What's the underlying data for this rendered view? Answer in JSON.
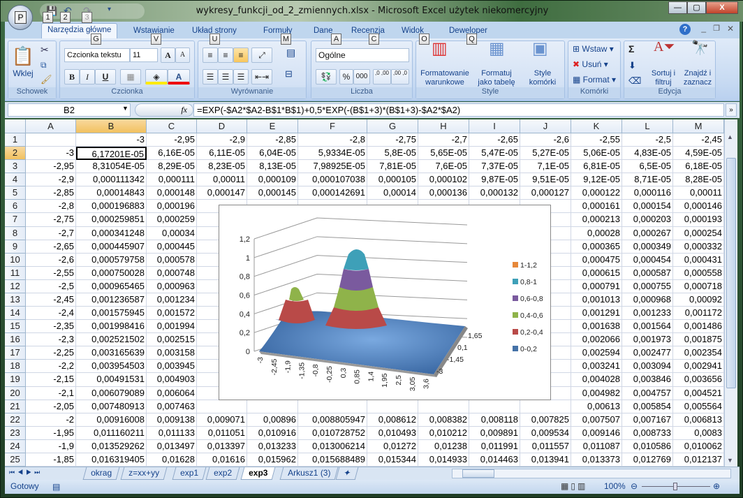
{
  "window": {
    "title": "wykresy_funkcji_od_2_zmiennych.xlsx - Microsoft Excel użytek niekomercyjny",
    "office_button_key": "P",
    "qat_keytips": [
      "1",
      "2",
      "3"
    ],
    "minimize": "—",
    "maximize": "▢",
    "close": "X"
  },
  "ribbon_tabs": [
    {
      "label": "Narzędzia główne",
      "key": "G",
      "active": true
    },
    {
      "label": "Wstawianie",
      "key": "V"
    },
    {
      "label": "Układ strony",
      "key": "U"
    },
    {
      "label": "Formuły",
      "key": "M"
    },
    {
      "label": "Dane",
      "key": "A"
    },
    {
      "label": "Recenzja",
      "key": "C"
    },
    {
      "label": "Widok",
      "key": "O"
    },
    {
      "label": "Deweloper",
      "key": "Q"
    }
  ],
  "ribbon": {
    "clipboard": {
      "label": "Schowek",
      "paste": "Wklej"
    },
    "font": {
      "label": "Czcionka",
      "font_name": "Czcionka tekstu",
      "font_size": "11",
      "bold": "B",
      "italic": "I",
      "underline": "U",
      "grow": "A",
      "shrink": "A",
      "font_color": "A"
    },
    "alignment": {
      "label": "Wyrównanie"
    },
    "number": {
      "label": "Liczba",
      "format": "Ogólne",
      "percent": "%",
      "thousands": "000",
      "inc_dec": ",0 ,00",
      "dec_dec": ",00 ,0"
    },
    "styles": {
      "label": "Style",
      "conditional": "Formatowanie warunkowe",
      "as_table": "Formatuj jako tabelę",
      "cell_styles": "Style komórki"
    },
    "cells": {
      "label": "Komórki",
      "insert": "Wstaw",
      "delete": "Usuń",
      "format": "Format"
    },
    "editing": {
      "label": "Edycja",
      "sum": "Σ",
      "sort": "Sortuj i filtruj",
      "find": "Znajdź i zaznacz"
    }
  },
  "formula_bar": {
    "name_box": "B2",
    "fx": "fx",
    "formula": "=EXP(-$A2*$A2-B$1*B$1)+0,5*EXP(-(B$1+3)*(B$1+3)-$A2*$A2)"
  },
  "grid": {
    "columns": [
      "A",
      "B",
      "C",
      "D",
      "E",
      "F",
      "G",
      "H",
      "I",
      "J",
      "K",
      "L",
      "M"
    ],
    "selected_cell": "B2",
    "rows": [
      {
        "n": "1",
        "cells": [
          "",
          "-3",
          "-2,95",
          "-2,9",
          "-2,85",
          "-2,8",
          "-2,75",
          "-2,7",
          "-2,65",
          "-2,6",
          "-2,55",
          "-2,5",
          "-2,45"
        ]
      },
      {
        "n": "2",
        "cells": [
          "-3",
          "6,17201E-05",
          "6,16E-05",
          "6,11E-05",
          "6,04E-05",
          "5,9334E-05",
          "5,8E-05",
          "5,65E-05",
          "5,47E-05",
          "5,27E-05",
          "5,06E-05",
          "4,83E-05",
          "4,59E-05"
        ]
      },
      {
        "n": "3",
        "cells": [
          "-2,95",
          "8,31054E-05",
          "8,29E-05",
          "8,23E-05",
          "8,13E-05",
          "7,98925E-05",
          "7,81E-05",
          "7,6E-05",
          "7,37E-05",
          "7,1E-05",
          "6,81E-05",
          "6,5E-05",
          "6,18E-05"
        ]
      },
      {
        "n": "4",
        "cells": [
          "-2,9",
          "0,000111342",
          "0,000111",
          "0,00011",
          "0,000109",
          "0,000107038",
          "0,000105",
          "0,000102",
          "9,87E-05",
          "9,51E-05",
          "9,12E-05",
          "8,71E-05",
          "8,28E-05"
        ]
      },
      {
        "n": "5",
        "cells": [
          "-2,85",
          "0,00014843",
          "0,000148",
          "0,000147",
          "0,000145",
          "0,000142691",
          "0,00014",
          "0,000136",
          "0,000132",
          "0,000127",
          "0,000122",
          "0,000116",
          "0,00011"
        ]
      },
      {
        "n": "6",
        "cells": [
          "-2,8",
          "0,000196883",
          "0,000196",
          "",
          "",
          "",
          "",
          "",
          "",
          "",
          "0,000161",
          "0,000154",
          "0,000146"
        ]
      },
      {
        "n": "7",
        "cells": [
          "-2,75",
          "0,000259851",
          "0,000259",
          "",
          "",
          "",
          "",
          "",
          "",
          "",
          "0,000213",
          "0,000203",
          "0,000193"
        ]
      },
      {
        "n": "8",
        "cells": [
          "-2,7",
          "0,000341248",
          "0,00034",
          "",
          "",
          "",
          "",
          "",
          "",
          "",
          "0,00028",
          "0,000267",
          "0,000254"
        ]
      },
      {
        "n": "9",
        "cells": [
          "-2,65",
          "0,000445907",
          "0,000445",
          "",
          "",
          "",
          "",
          "",
          "",
          "",
          "0,000365",
          "0,000349",
          "0,000332"
        ]
      },
      {
        "n": "10",
        "cells": [
          "-2,6",
          "0,000579758",
          "0,000578",
          "",
          "",
          "",
          "",
          "",
          "",
          "",
          "0,000475",
          "0,000454",
          "0,000431"
        ]
      },
      {
        "n": "11",
        "cells": [
          "-2,55",
          "0,000750028",
          "0,000748",
          "",
          "",
          "",
          "",
          "",
          "",
          "",
          "0,000615",
          "0,000587",
          "0,000558"
        ]
      },
      {
        "n": "12",
        "cells": [
          "-2,5",
          "0,000965465",
          "0,000963",
          "",
          "",
          "",
          "",
          "",
          "",
          "",
          "0,000791",
          "0,000755",
          "0,000718"
        ]
      },
      {
        "n": "13",
        "cells": [
          "-2,45",
          "0,001236587",
          "0,001234",
          "",
          "",
          "",
          "",
          "",
          "",
          "",
          "0,001013",
          "0,000968",
          "0,00092"
        ]
      },
      {
        "n": "14",
        "cells": [
          "-2,4",
          "0,001575945",
          "0,001572",
          "",
          "",
          "",
          "",
          "",
          "",
          "",
          "0,001291",
          "0,001233",
          "0,001172"
        ]
      },
      {
        "n": "15",
        "cells": [
          "-2,35",
          "0,001998416",
          "0,001994",
          "",
          "",
          "",
          "",
          "",
          "",
          "",
          "0,001638",
          "0,001564",
          "0,001486"
        ]
      },
      {
        "n": "16",
        "cells": [
          "-2,3",
          "0,002521502",
          "0,002515",
          "",
          "",
          "",
          "",
          "",
          "",
          "",
          "0,002066",
          "0,001973",
          "0,001875"
        ]
      },
      {
        "n": "17",
        "cells": [
          "-2,25",
          "0,003165639",
          "0,003158",
          "",
          "",
          "",
          "",
          "",
          "",
          "",
          "0,002594",
          "0,002477",
          "0,002354"
        ]
      },
      {
        "n": "18",
        "cells": [
          "-2,2",
          "0,003954503",
          "0,003945",
          "",
          "",
          "",
          "",
          "",
          "",
          "",
          "0,003241",
          "0,003094",
          "0,002941"
        ]
      },
      {
        "n": "19",
        "cells": [
          "-2,15",
          "0,00491531",
          "0,004903",
          "",
          "",
          "",
          "",
          "",
          "",
          "",
          "0,004028",
          "0,003846",
          "0,003656"
        ]
      },
      {
        "n": "20",
        "cells": [
          "-2,1",
          "0,006079089",
          "0,006064",
          "",
          "",
          "",
          "",
          "",
          "",
          "",
          "0,004982",
          "0,004757",
          "0,004521"
        ]
      },
      {
        "n": "21",
        "cells": [
          "-2,05",
          "0,007480913",
          "0,007463",
          "",
          "",
          "",
          "",
          "",
          "",
          "",
          "0,00613",
          "0,005854",
          "0,005564"
        ]
      },
      {
        "n": "22",
        "cells": [
          "-2",
          "0,00916008",
          "0,009138",
          "0,009071",
          "0,00896",
          "0,008805947",
          "0,008612",
          "0,008382",
          "0,008118",
          "0,007825",
          "0,007507",
          "0,007167",
          "0,006813"
        ]
      },
      {
        "n": "23",
        "cells": [
          "-1,95",
          "0,011160211",
          "0,011133",
          "0,011051",
          "0,010916",
          "0,010728752",
          "0,010493",
          "0,010212",
          "0,009891",
          "0,009534",
          "0,009146",
          "0,008733",
          "0,0083"
        ]
      },
      {
        "n": "24",
        "cells": [
          "-1,9",
          "0,013529262",
          "0,013497",
          "0,013397",
          "0,013233",
          "0,013006214",
          "0,01272",
          "0,01238",
          "0,011991",
          "0,011557",
          "0,011087",
          "0,010586",
          "0,010062"
        ]
      },
      {
        "n": "25",
        "cells": [
          "-1,85",
          "0,016319405",
          "0,01628",
          "0,01616",
          "0,015962",
          "0,015688489",
          "0,015344",
          "0,014933",
          "0,014463",
          "0,013941",
          "0,013373",
          "0,012769",
          "0,012137"
        ]
      }
    ]
  },
  "sheets": [
    {
      "label": "okrag"
    },
    {
      "label": "z=xx+yy"
    },
    {
      "label": "exp1"
    },
    {
      "label": "exp2"
    },
    {
      "label": "exp3",
      "active": true
    },
    {
      "label": "Arkusz1 (3)"
    }
  ],
  "status": {
    "ready": "Gotowy",
    "zoom": "100%"
  },
  "chart_data": {
    "type": "surface",
    "z_ticks": [
      "0",
      "0,2",
      "0,4",
      "0,6",
      "0,8",
      "1",
      "1,2"
    ],
    "zlim": [
      0,
      1.2
    ],
    "x_ticks": [
      "-3",
      "-2,45",
      "-1,9",
      "-1,35",
      "-0,8",
      "-0,25",
      "0,3",
      "0,85",
      "1,4",
      "1,95",
      "2,5",
      "3,05",
      "3,6"
    ],
    "y_ticks": [
      "1,65",
      "0,1",
      "-1,45",
      "-3"
    ],
    "function": "EXP(-y*y-x*x)+0,5*EXP(-(x+3)*(x+3)-y*y)",
    "peaks": [
      {
        "x": 0,
        "y": 0,
        "z": 1
      },
      {
        "x": -3,
        "y": 0,
        "z": 0.5
      }
    ],
    "grid": true,
    "legend_position": "right",
    "legend": [
      {
        "label": "1-1,2",
        "color": "#e6883a"
      },
      {
        "label": "0,8-1",
        "color": "#3ea0b8"
      },
      {
        "label": "0,6-0,8",
        "color": "#7a5a9e"
      },
      {
        "label": "0,4-0,6",
        "color": "#8fb34a"
      },
      {
        "label": "0,2-0,4",
        "color": "#b94a48"
      },
      {
        "label": "0-0,2",
        "color": "#4572a7"
      }
    ]
  }
}
